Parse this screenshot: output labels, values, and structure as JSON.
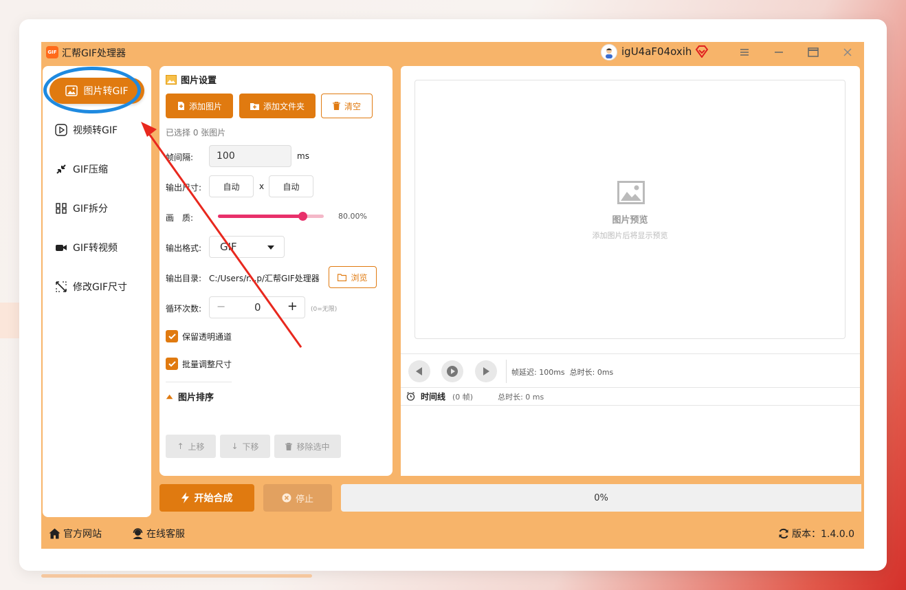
{
  "app": {
    "title": "汇帮GIF处理器",
    "logo_text": "GIF",
    "username": "igU4aF04oxih",
    "accent": "#e07a10",
    "bg": "#f7b46a"
  },
  "sidebar": {
    "items": [
      {
        "label": "图片转GIF",
        "icon": "image-icon",
        "active": true
      },
      {
        "label": "视频转GIF",
        "icon": "play-icon"
      },
      {
        "label": "GIF压缩",
        "icon": "compress-icon"
      },
      {
        "label": "GIF拆分",
        "icon": "split-icon"
      },
      {
        "label": "GIF转视频",
        "icon": "video-icon"
      },
      {
        "label": "修改GIF尺寸",
        "icon": "resize-icon"
      }
    ]
  },
  "settings": {
    "title": "图片设置",
    "add_image": "添加图片",
    "add_folder": "添加文件夹",
    "clear": "清空",
    "selected": "已选择 0 张图片",
    "frame_interval_label": "帧间隔:",
    "frame_interval_value": "100",
    "frame_interval_unit": "ms",
    "output_size_label": "输出尺寸:",
    "width": "自动",
    "height": "自动",
    "size_sep": "x",
    "quality_label": "画　质:",
    "quality_value": "80.00%",
    "quality_fraction": 0.8,
    "format_label": "输出格式:",
    "format_value": "GIF",
    "dir_label": "输出目录:",
    "dir_value": "C:/Users/r...p/汇帮GIF处理器",
    "browse": "浏览",
    "loop_label": "循环次数:",
    "loop_value": "0",
    "loop_hint": "(0=无限)",
    "keep_alpha": "保留透明通道",
    "batch_resize": "批量调整尺寸"
  },
  "sort": {
    "title": "图片排序",
    "up": "上移",
    "down": "下移",
    "remove": "移除选中"
  },
  "preview": {
    "title": "图片预览",
    "hint": "添加图片后将显示预览"
  },
  "player": {
    "info": "帧延迟: 100ms  总时长: 0ms"
  },
  "timeline": {
    "label": "时间线",
    "frames": "(0 帧)",
    "duration": "总时长: 0 ms"
  },
  "actions": {
    "start": "开始合成",
    "stop": "停止",
    "progress": "0%"
  },
  "footer": {
    "website": "官方网站",
    "support": "在线客服",
    "version": "版本：1.4.0.0"
  }
}
